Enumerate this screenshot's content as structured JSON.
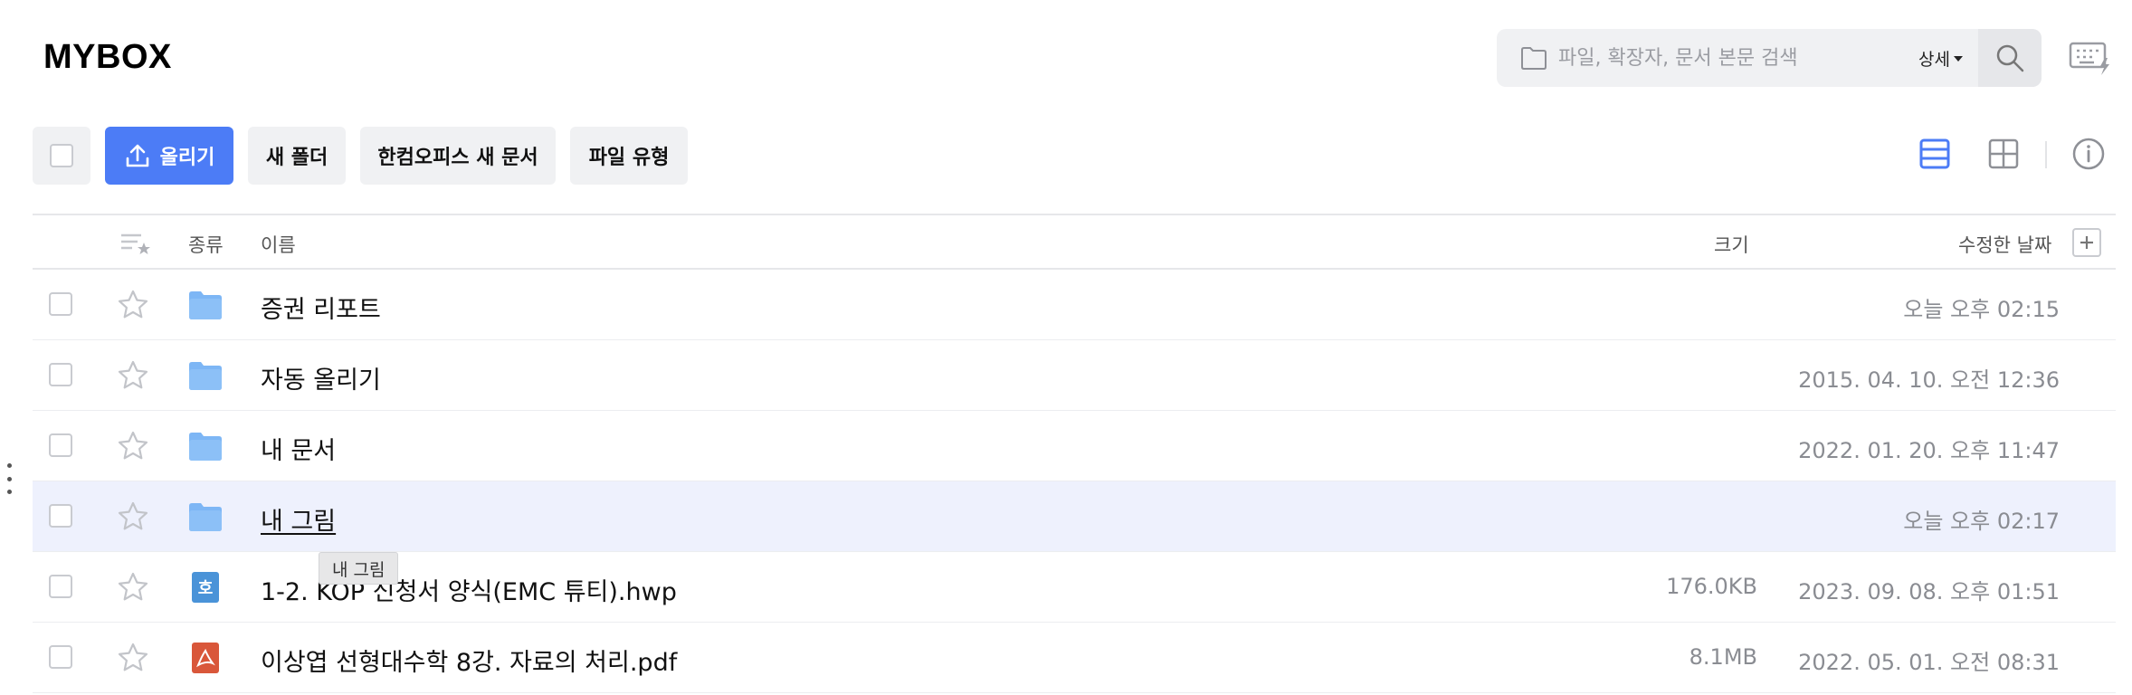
{
  "app": {
    "title": "MYBOX"
  },
  "search": {
    "placeholder": "파일, 확장자, 문서 본문 검색",
    "detail_label": "상세"
  },
  "toolbar": {
    "upload_label": "올리기",
    "new_folder_label": "새 폴더",
    "hancom_new_doc_label": "한컴오피스 새 문서",
    "file_type_label": "파일 유형"
  },
  "table": {
    "headers": {
      "kind": "종류",
      "name": "이름",
      "size": "크기",
      "modified": "수정한 날짜"
    },
    "rows": [
      {
        "type": "folder",
        "name": "증권 리포트",
        "size": "",
        "date": "오늘 오후 02:15",
        "selected": false
      },
      {
        "type": "folder",
        "name": "자동 올리기",
        "size": "",
        "date": "2015. 04. 10. 오전 12:36",
        "selected": false
      },
      {
        "type": "folder",
        "name": "내 문서",
        "size": "",
        "date": "2022. 01. 20. 오후 11:47",
        "selected": false
      },
      {
        "type": "folder",
        "name": "내 그림",
        "size": "",
        "date": "오늘 오후 02:17",
        "selected": true
      },
      {
        "type": "hwp",
        "name": "1-2. KOP 신청서 양식(EMC 튜티).hwp",
        "size": "176.0KB",
        "date": "2023. 09. 08. 오후 01:51",
        "selected": false
      },
      {
        "type": "pdf",
        "name": "이상엽 선형대수학 8강. 자료의 처리.pdf",
        "size": "8.1MB",
        "date": "2022. 05. 01. 오전 08:31",
        "selected": false
      }
    ]
  },
  "tooltip": {
    "text": "내 그림"
  },
  "icons": {
    "folder": "folder-icon",
    "hwp": "hwp-file-icon",
    "pdf": "pdf-file-icon",
    "hwp_glyph": "호"
  },
  "colors": {
    "accent": "#4c7cf6",
    "folder": "#7db6f5",
    "hwp": "#4a93d8",
    "pdf": "#d9573a",
    "selected_row": "#eef1fd"
  }
}
